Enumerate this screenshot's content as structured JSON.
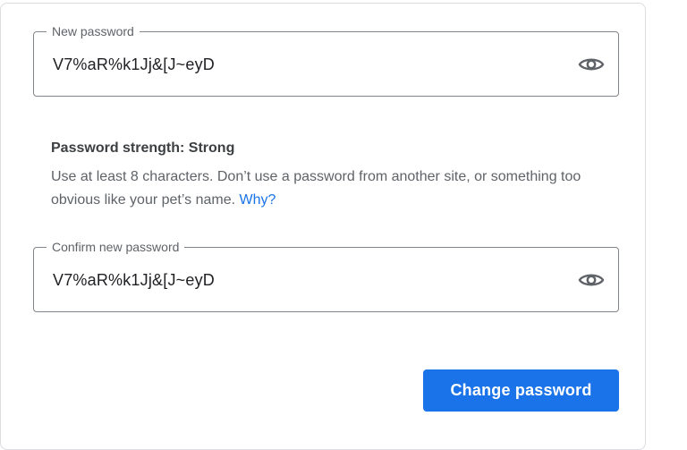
{
  "new_password": {
    "label": "New password",
    "value": "V7%aR%k1Jj&[J~eyD",
    "toggle_icon": "eye-icon"
  },
  "strength": {
    "title": "Password strength: Strong",
    "hint_text": "Use at least 8 characters. Don’t use a password from another site, or something too obvious like your pet’s name.",
    "why_link": "Why?"
  },
  "confirm_password": {
    "label": "Confirm new password",
    "value": "V7%aR%k1Jj&[J~eyD",
    "toggle_icon": "eye-icon"
  },
  "actions": {
    "submit_label": "Change password"
  },
  "colors": {
    "accent": "#1a73e8",
    "field_border": "#80868b",
    "card_border": "#dadce0"
  }
}
